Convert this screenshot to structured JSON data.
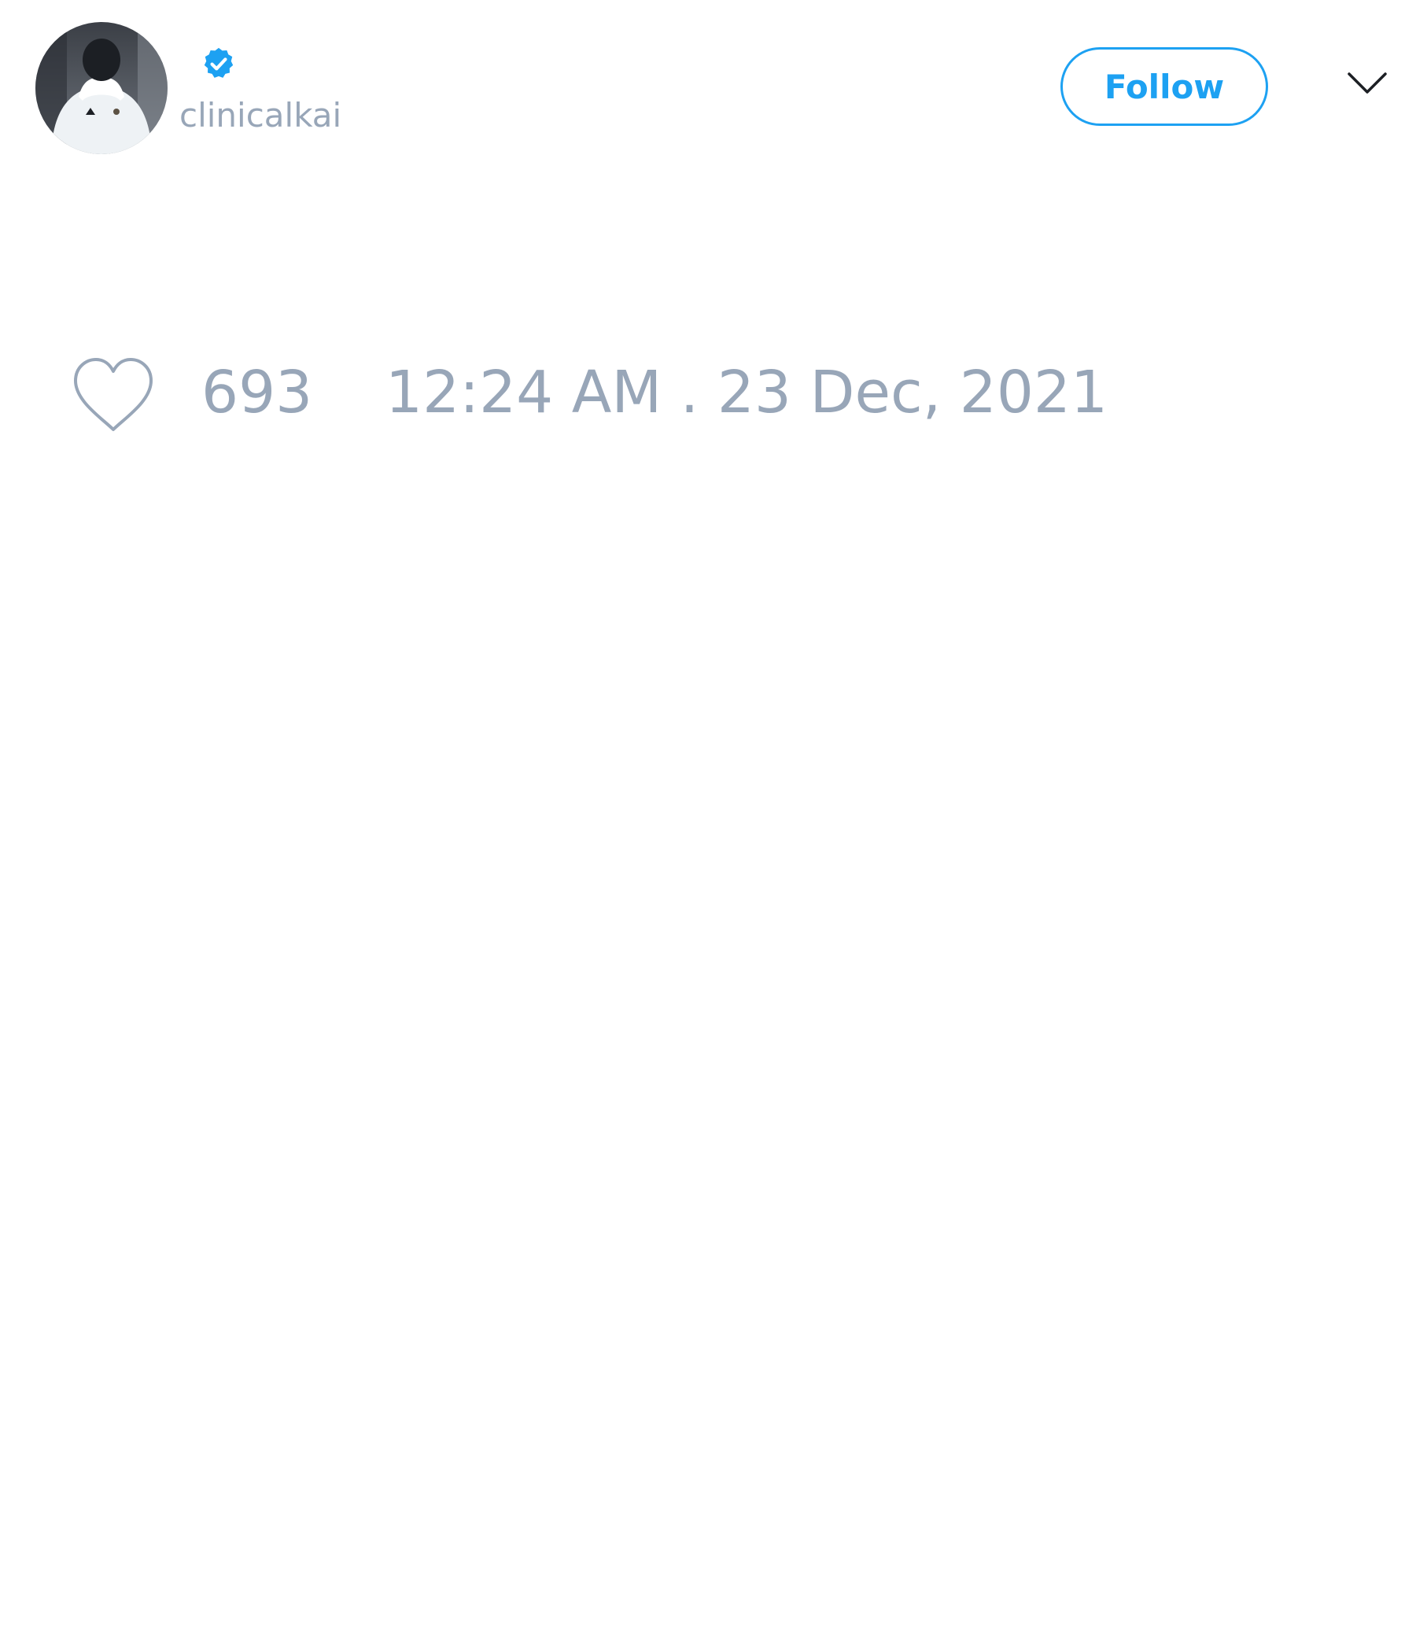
{
  "tweet": {
    "author": {
      "handle": "clinicalkai",
      "verified": true
    },
    "follow_label": "Follow",
    "likes": "693",
    "timestamp": "12:24 AM . 23 Dec, 2021"
  },
  "icons": {
    "verified": "verified-badge-icon",
    "menu": "chevron-down-icon",
    "like": "heart-icon"
  },
  "colors": {
    "accent": "#1da1f2",
    "muted_text": "#98a6b8",
    "background": "#ffffff"
  }
}
